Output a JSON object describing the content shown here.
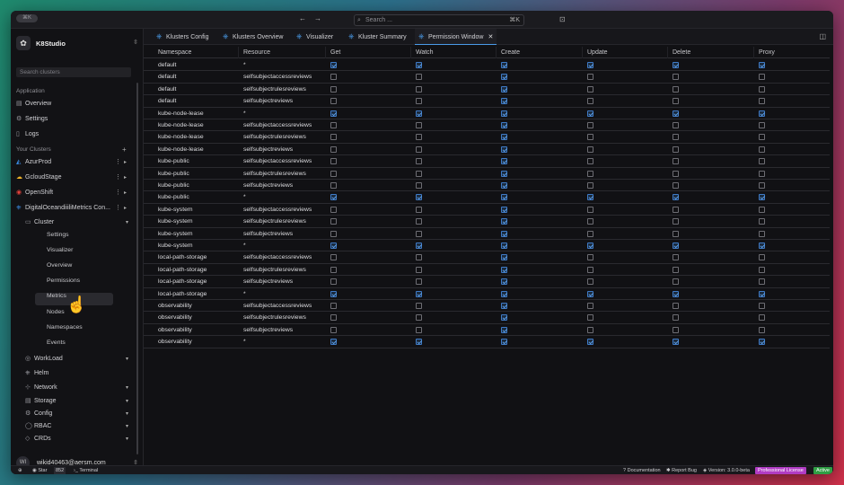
{
  "topbar": {
    "window_pill": "⌘K",
    "back": "←",
    "forward": "→",
    "search_placeholder": "Search ...",
    "search_shortcut": "⌘K"
  },
  "sidebar": {
    "brand": "K8Studio",
    "search_placeholder": "Search clusters",
    "application_label": "Application",
    "app_items": [
      {
        "label": "Overview",
        "icon": "overview-icon"
      },
      {
        "label": "Settings",
        "icon": "gear-icon"
      },
      {
        "label": "Logs",
        "icon": "logs-icon"
      }
    ],
    "clusters_label": "Your Clusters",
    "clusters": [
      {
        "label": "AzurProd",
        "icon": "azure-icon",
        "color": "#3b8ee8"
      },
      {
        "label": "GcloudStage",
        "icon": "gcloud-icon",
        "color": "#f0b429"
      },
      {
        "label": "OpenShift",
        "icon": "openshift-icon",
        "color": "#e2413b"
      },
      {
        "label": "DigitalOceandiiiliMetrics Con...",
        "icon": "kubernetes-icon",
        "color": "#3b8ee8"
      }
    ],
    "cluster_group": "Cluster",
    "cluster_sub": [
      "Settings",
      "Visualizer",
      "Overview",
      "Permissions",
      "Metrics",
      "Nodes",
      "Namespaces",
      "Events"
    ],
    "groups": [
      {
        "label": "WorkLoad",
        "icon": "workload-icon"
      },
      {
        "label": "Helm",
        "icon": "helm-icon"
      },
      {
        "label": "Network",
        "icon": "network-icon"
      },
      {
        "label": "Storage",
        "icon": "storage-icon"
      },
      {
        "label": "Config",
        "icon": "config-icon"
      },
      {
        "label": "RBAC",
        "icon": "rbac-icon"
      },
      {
        "label": "CRDs",
        "icon": "crds-icon"
      }
    ],
    "user": {
      "initials": "WI",
      "email": "wikid40463@aersm.com"
    }
  },
  "tabs": [
    {
      "label": "Klusters Config"
    },
    {
      "label": "Klusters Overview"
    },
    {
      "label": "Visualizer"
    },
    {
      "label": "Kluster Summary"
    },
    {
      "label": "Permission Window",
      "active": true
    }
  ],
  "table": {
    "columns": [
      "Namespace",
      "Resource",
      "Get",
      "Watch",
      "Create",
      "Update",
      "Delete",
      "Proxy"
    ],
    "rows": [
      {
        "ns": "default",
        "res": "*",
        "p": [
          1,
          1,
          1,
          1,
          1,
          1
        ]
      },
      {
        "ns": "default",
        "res": "selfsubjectaccessreviews",
        "p": [
          0,
          0,
          1,
          0,
          0,
          0
        ]
      },
      {
        "ns": "default",
        "res": "selfsubjectrulesreviews",
        "p": [
          0,
          0,
          1,
          0,
          0,
          0
        ]
      },
      {
        "ns": "default",
        "res": "selfsubjectreviews",
        "p": [
          0,
          0,
          1,
          0,
          0,
          0
        ]
      },
      {
        "ns": "kube-node-lease",
        "res": "*",
        "p": [
          1,
          1,
          1,
          1,
          1,
          1
        ]
      },
      {
        "ns": "kube-node-lease",
        "res": "selfsubjectaccessreviews",
        "p": [
          0,
          0,
          1,
          0,
          0,
          0
        ]
      },
      {
        "ns": "kube-node-lease",
        "res": "selfsubjectrulesreviews",
        "p": [
          0,
          0,
          1,
          0,
          0,
          0
        ]
      },
      {
        "ns": "kube-node-lease",
        "res": "selfsubjectreviews",
        "p": [
          0,
          0,
          1,
          0,
          0,
          0
        ]
      },
      {
        "ns": "kube-public",
        "res": "selfsubjectaccessreviews",
        "p": [
          0,
          0,
          1,
          0,
          0,
          0
        ]
      },
      {
        "ns": "kube-public",
        "res": "selfsubjectrulesreviews",
        "p": [
          0,
          0,
          1,
          0,
          0,
          0
        ]
      },
      {
        "ns": "kube-public",
        "res": "selfsubjectreviews",
        "p": [
          0,
          0,
          1,
          0,
          0,
          0
        ]
      },
      {
        "ns": "kube-public",
        "res": "*",
        "p": [
          1,
          1,
          1,
          1,
          1,
          1
        ]
      },
      {
        "ns": "kube-system",
        "res": "selfsubjectaccessreviews",
        "p": [
          0,
          0,
          1,
          0,
          0,
          0
        ]
      },
      {
        "ns": "kube-system",
        "res": "selfsubjectrulesreviews",
        "p": [
          0,
          0,
          1,
          0,
          0,
          0
        ]
      },
      {
        "ns": "kube-system",
        "res": "selfsubjectreviews",
        "p": [
          0,
          0,
          1,
          0,
          0,
          0
        ]
      },
      {
        "ns": "kube-system",
        "res": "*",
        "p": [
          1,
          1,
          1,
          1,
          1,
          1
        ]
      },
      {
        "ns": "local-path-storage",
        "res": "selfsubjectaccessreviews",
        "p": [
          0,
          0,
          1,
          0,
          0,
          0
        ]
      },
      {
        "ns": "local-path-storage",
        "res": "selfsubjectrulesreviews",
        "p": [
          0,
          0,
          1,
          0,
          0,
          0
        ]
      },
      {
        "ns": "local-path-storage",
        "res": "selfsubjectreviews",
        "p": [
          0,
          0,
          1,
          0,
          0,
          0
        ]
      },
      {
        "ns": "local-path-storage",
        "res": "*",
        "p": [
          1,
          1,
          1,
          1,
          1,
          1
        ]
      },
      {
        "ns": "observability",
        "res": "selfsubjectaccessreviews",
        "p": [
          0,
          0,
          1,
          0,
          0,
          0
        ]
      },
      {
        "ns": "observability",
        "res": "selfsubjectrulesreviews",
        "p": [
          0,
          0,
          1,
          0,
          0,
          0
        ]
      },
      {
        "ns": "observability",
        "res": "selfsubjectreviews",
        "p": [
          0,
          0,
          1,
          0,
          0,
          0
        ]
      },
      {
        "ns": "observability",
        "res": "*",
        "p": [
          1,
          1,
          1,
          1,
          1,
          1
        ]
      }
    ]
  },
  "status": {
    "star": "Star",
    "star_count": "852",
    "terminal": "Terminal",
    "documentation": "Documentation",
    "report_bug": "Report Bug",
    "version": "Version: 3.0.0-beta",
    "license": "Professional License",
    "active": "Active",
    "license_color": "#b13cc4",
    "active_color": "#2f9e44"
  }
}
